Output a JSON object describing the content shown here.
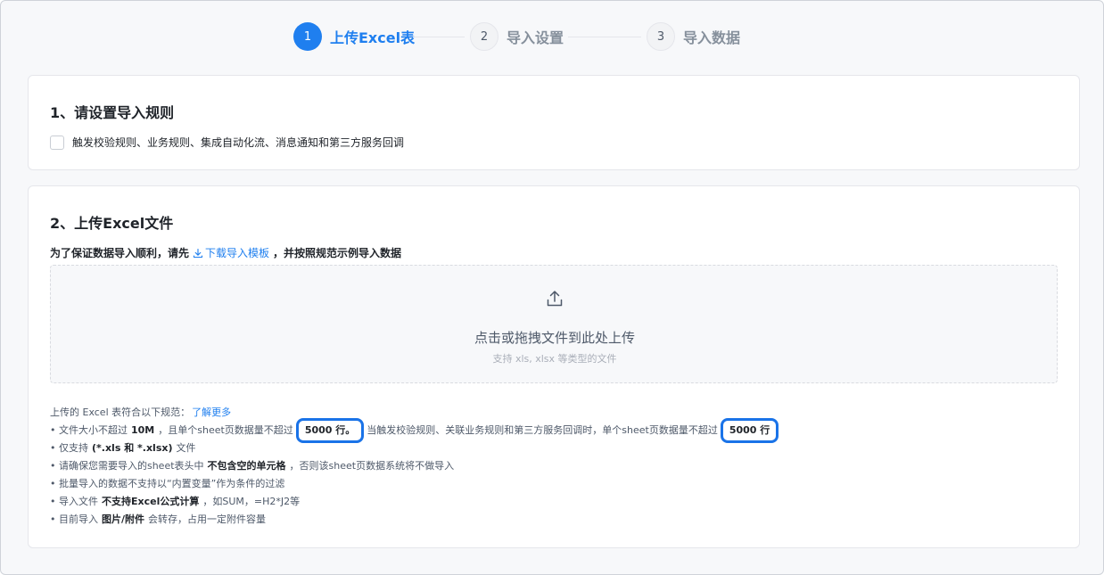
{
  "steps": [
    {
      "num": "1",
      "label": "上传Excel表",
      "state": "active"
    },
    {
      "num": "2",
      "label": "导入设置",
      "state": "inactive"
    },
    {
      "num": "3",
      "label": "导入数据",
      "state": "inactive"
    }
  ],
  "section1": {
    "title": "1、请设置导入规则",
    "checkbox_label": "触发校验规则、业务规则、集成自动化流、消息通知和第三方服务回调"
  },
  "section2": {
    "title": "2、上传Excel文件",
    "intro_before": "为了保证数据导入顺利，请先",
    "download_link": "下载导入模板",
    "intro_after": "，并按照规范示例导入数据",
    "dropzone": {
      "icon": "upload-icon",
      "title": "点击或拖拽文件到此处上传",
      "subtitle": "支持 xls, xlsx 等类型的文件"
    },
    "rules": {
      "intro": "上传的 Excel 表符合以下规范：",
      "learn_more": "了解更多",
      "r1_a": "• 文件大小不超过",
      "r1_b": "10M",
      "r1_c": "，且单个sheet页数据量不超过",
      "r1_d": "5000 行。",
      "r1_e": "当触发校验规则、关联业务规则和第三方服务回调时，单个sheet页数据量不超过",
      "r1_f": "5000 行",
      "r2_a": "• 仅支持",
      "r2_b": "(*.xls 和 *.xlsx)",
      "r2_c": "文件",
      "r3_a": "• 请确保您需要导入的sheet表头中",
      "r3_b": "不包含空的单元格",
      "r3_c": "，否则该sheet页数据系统将不做导入",
      "r4": "• 批量导入的数据不支持以“内置变量”作为条件的过滤",
      "r5_a": "• 导入文件",
      "r5_b": "不支持Excel公式计算",
      "r5_c": "，如SUM，=H2*J2等",
      "r6_a": "• 目前导入",
      "r6_b": "图片/附件",
      "r6_c": "会转存，占用一定附件容量"
    }
  },
  "colors": {
    "accent": "#1f7fef",
    "highlight": "#1a73e8"
  }
}
